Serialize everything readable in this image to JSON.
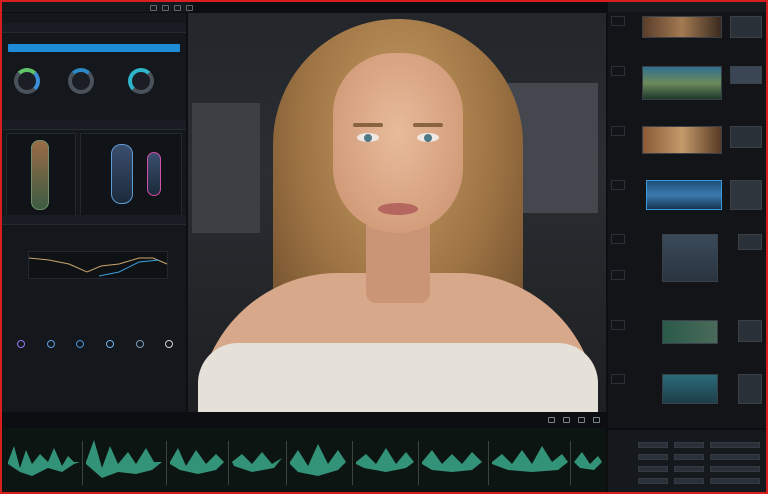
{
  "menubar": {
    "items": [
      "",
      "",
      "",
      ""
    ]
  },
  "left_panel": {
    "header": "",
    "dropdown_value": "",
    "dial_labels": [
      "",
      "",
      ""
    ],
    "scopes_header": "",
    "scopes_tab": "",
    "curves_header": "",
    "tools": [
      "",
      "",
      "",
      "",
      "",
      ""
    ]
  },
  "right_panel": {
    "header": "",
    "bottom_title": ""
  },
  "colors": {
    "accent": "#1f8bd6",
    "border": "#d62020",
    "wave": "#3aa98a",
    "purple": "#8b7cf0"
  },
  "icons": [
    "play-icon",
    "grid-icon",
    "settings-icon",
    "close-icon"
  ]
}
